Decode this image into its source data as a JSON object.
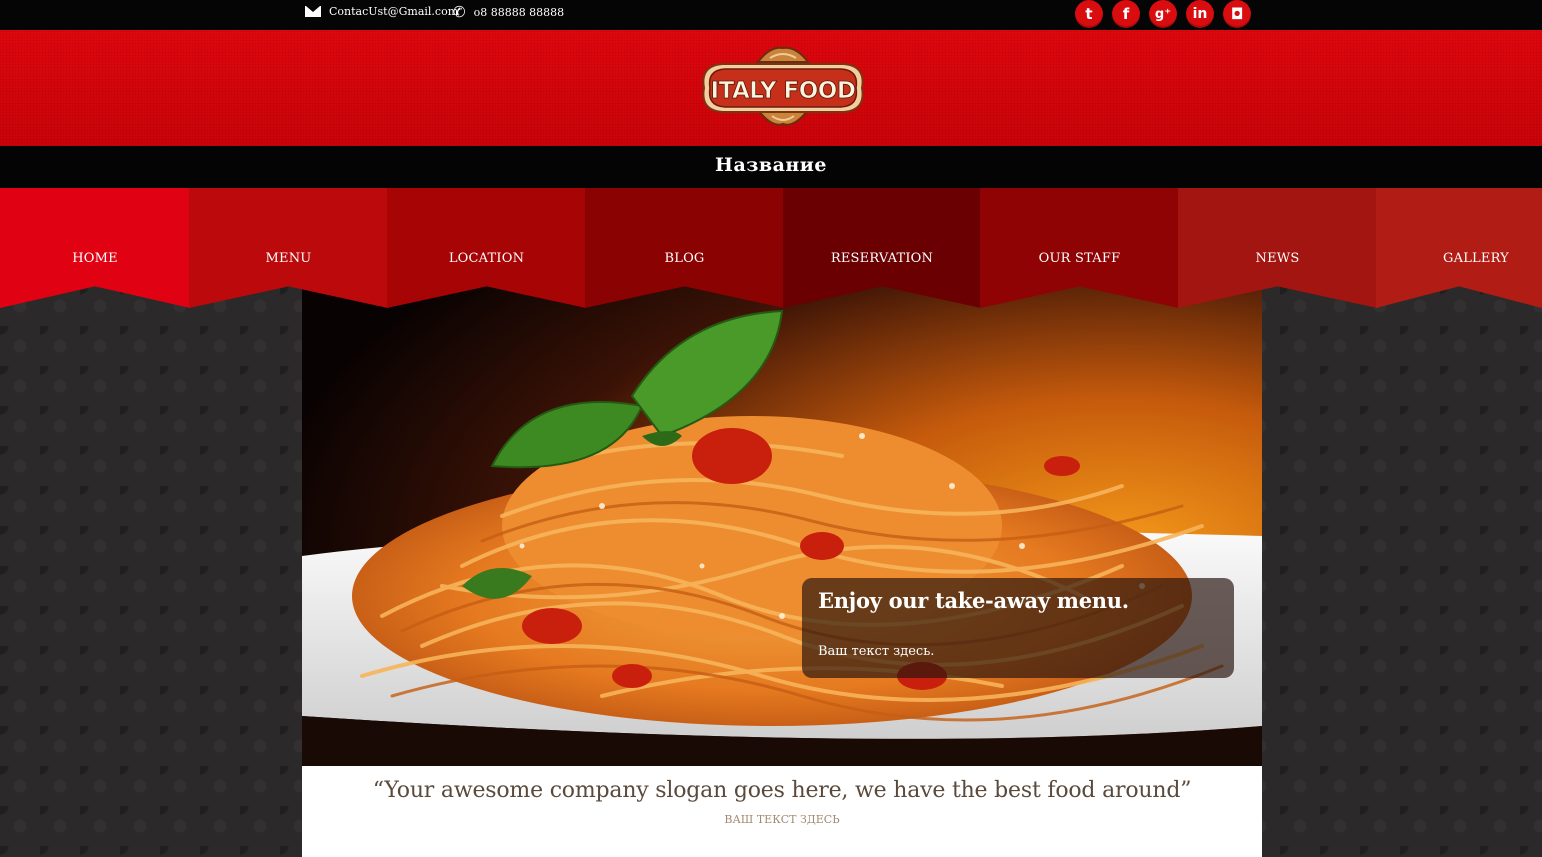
{
  "topbar": {
    "email": "ContacUst@Gmail.com",
    "phone": "o8 88888 88888",
    "socials": [
      {
        "name": "twitter",
        "glyph": "t"
      },
      {
        "name": "facebook",
        "glyph": "f"
      },
      {
        "name": "google-plus",
        "glyph": "g⁺"
      },
      {
        "name": "linkedin",
        "glyph": "in"
      },
      {
        "name": "instagram",
        "glyph": "◘"
      }
    ],
    "social_color": "#d90d0f"
  },
  "header": {
    "logo_text": "ITALY FOOD",
    "brand_color": "#d7060c"
  },
  "title": {
    "text": "Название"
  },
  "nav": {
    "items": [
      {
        "label": "HOME",
        "color": "#e00212"
      },
      {
        "label": "MENU",
        "color": "#bc0a0c"
      },
      {
        "label": "LOCATION",
        "color": "#a70406"
      },
      {
        "label": "BLOG",
        "color": "#8b0203"
      },
      {
        "label": "RESERVATION",
        "color": "#6a0001"
      },
      {
        "label": "OUR STAFF",
        "color": "#8f0304"
      },
      {
        "label": "NEWS",
        "color": "#a31510"
      },
      {
        "label": "GALLERY",
        "color": "#b11c14"
      }
    ]
  },
  "hero": {
    "caption_title": "Enjoy our take-away menu.",
    "caption_text": "Ваш текст здесь."
  },
  "slogan": {
    "text": "“Your awesome company slogan goes here, we have the best food around”",
    "subtext": "ВАШ ТЕКСТ ЗДЕСЬ"
  }
}
